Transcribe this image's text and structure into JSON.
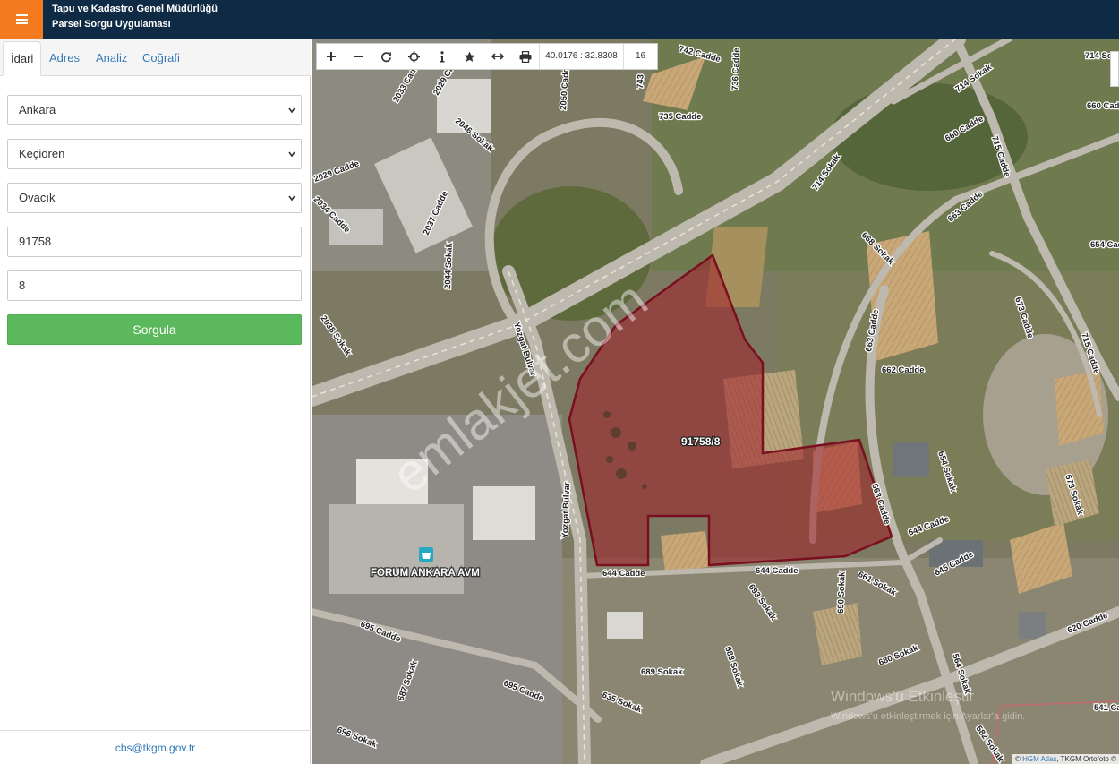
{
  "header": {
    "title_line1": "Tapu ve Kadastro Genel Müdürlüğü",
    "title_line2": "Parsel Sorgu Uygulaması"
  },
  "tabs": [
    {
      "label": "İdari"
    },
    {
      "label": "Adres"
    },
    {
      "label": "Analiz"
    },
    {
      "label": "Coğrafi"
    }
  ],
  "form": {
    "il": "Ankara",
    "ilce": "Keçiören",
    "mahalle": "Ovacık",
    "ada": "91758",
    "parsel": "8",
    "submit_label": "Sorgula"
  },
  "footer": {
    "email": "cbs@tkgm.gov.tr"
  },
  "map": {
    "coordinates": "40.0176 : 32.8308",
    "zoom_level": "16",
    "parcel_label": "91758/8",
    "watermark": "emlakjet.com",
    "poi_label": "FORUM ANKARA AVM",
    "attribution_prefix": "© ",
    "attribution_link": "HGM Atlas",
    "attribution_rest": ", TKGM Ortofoto ©",
    "windows_notice": "Windows'u Etkinleştir",
    "windows_notice_sub": "Windows'u etkinleştirmek için Ayarlar'a gidin.",
    "street_labels": {
      "s1": "742 Cadde",
      "s2": "736 Cadde",
      "s3": "735 Cadde",
      "s4": "743",
      "s5": "2050 Cadde",
      "s6": "2033 Cadde",
      "s7": "2029 Cadde",
      "s8": "2046 Sokak",
      "s9": "2029 Cadde",
      "s10": "2034 Cadde",
      "s11": "2037 Cadde",
      "s12": "2044 Sokak",
      "s13": "2038 Sokak",
      "s14": "Yozgat Bulvar",
      "s15": "Yozgat Bulvar",
      "s16": "644 Cadde",
      "s17": "644 Cadde",
      "s18": "644 Cadde",
      "s19": "714 Sokak",
      "s20": "714 Sokak",
      "s21": "660 Cadde",
      "s22": "660 Cadde",
      "s23": "715 Cadde",
      "s24": "714 Sokak",
      "s25": "663 Cadde",
      "s26": "668 Sokak",
      "s27": "654 Cadde",
      "s28": "673 Cadde",
      "s29": "663 Cadde",
      "s30": "662 Cadde",
      "s31": "715 Cadde",
      "s32": "654 Sokak",
      "s33": "663 Cadde",
      "s34": "673 Sokak",
      "s35": "645 Cadde",
      "s36": "661 Sokak",
      "s37": "690 Sokak",
      "s38": "693 Sokak",
      "s39": "688 Sokak",
      "s40": "689 Sokak",
      "s41": "695 Cadde",
      "s42": "695 Cadde",
      "s43": "687 Sokak",
      "s44": "635 Sokak",
      "s45": "696 Sokak",
      "s46": "680 Sokak",
      "s47": "564 Sokak",
      "s48": "620 Cadde",
      "s49": "541 Cad",
      "s50": "582 Sokak"
    }
  }
}
